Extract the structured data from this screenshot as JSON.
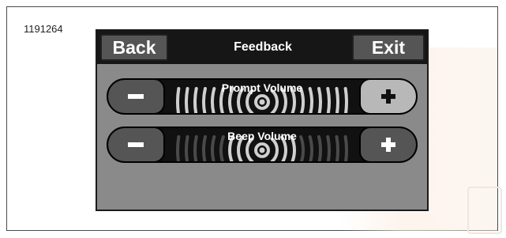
{
  "figure_id": "1191264",
  "header": {
    "back_label": "Back",
    "title": "Feedback",
    "exit_label": "Exit"
  },
  "sliders": [
    {
      "label": "Prompt Volume",
      "level": 1.0,
      "plus_highlighted": true
    },
    {
      "label": "Beep Volume",
      "level": 0.35,
      "plus_highlighted": false
    }
  ],
  "icons": [
    "minus-icon",
    "plus-icon",
    "volume-waves-icon"
  ],
  "colors": {
    "screen_bg": "#8a8a8a",
    "header_bg": "#161616",
    "button_bg": "#555555",
    "highlight_button_bg": "#b8b8b8",
    "wave_on": "#cfcfcf",
    "wave_off": "#4a4a4a"
  }
}
